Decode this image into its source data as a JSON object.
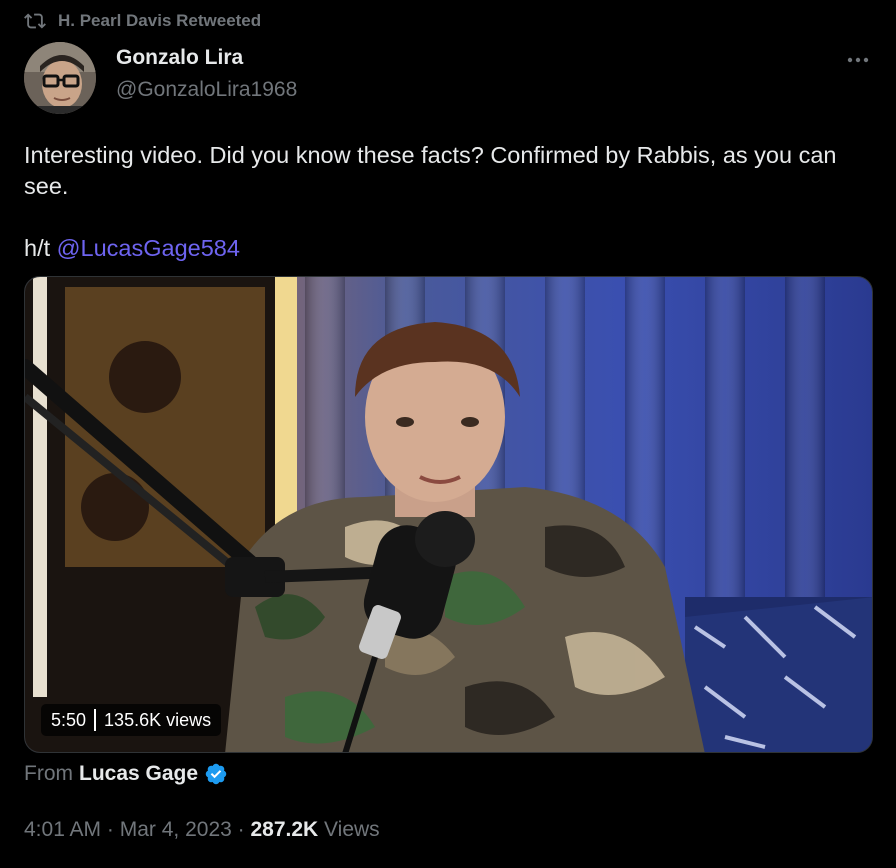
{
  "retweet": {
    "label": "H. Pearl Davis Retweeted",
    "icon": "retweet-icon"
  },
  "author": {
    "name": "Gonzalo Lira",
    "handle": "@GonzaloLira1968",
    "avatar_icon": "avatar"
  },
  "more_icon": "more-icon",
  "tweet": {
    "text_line": "Interesting video. Did you know these facts? Confirmed by Rabbis, as you can see.",
    "ht_prefix": "h/t ",
    "mention": "@LucasGage584"
  },
  "media": {
    "duration": "5:50",
    "views": "135.6K views"
  },
  "source": {
    "prefix": "From",
    "name": "Lucas Gage",
    "verified_icon": "verified-badge-icon"
  },
  "meta": {
    "time": "4:01 AM",
    "separator": " · ",
    "date": "Mar 4, 2023",
    "view_count": "287.2K",
    "views_label": " Views"
  },
  "colors": {
    "background": "#000000",
    "primary_text": "#e7e9ea",
    "secondary_text": "#71767b",
    "mention": "#6e64f0",
    "verified": "#1d9bf0"
  }
}
